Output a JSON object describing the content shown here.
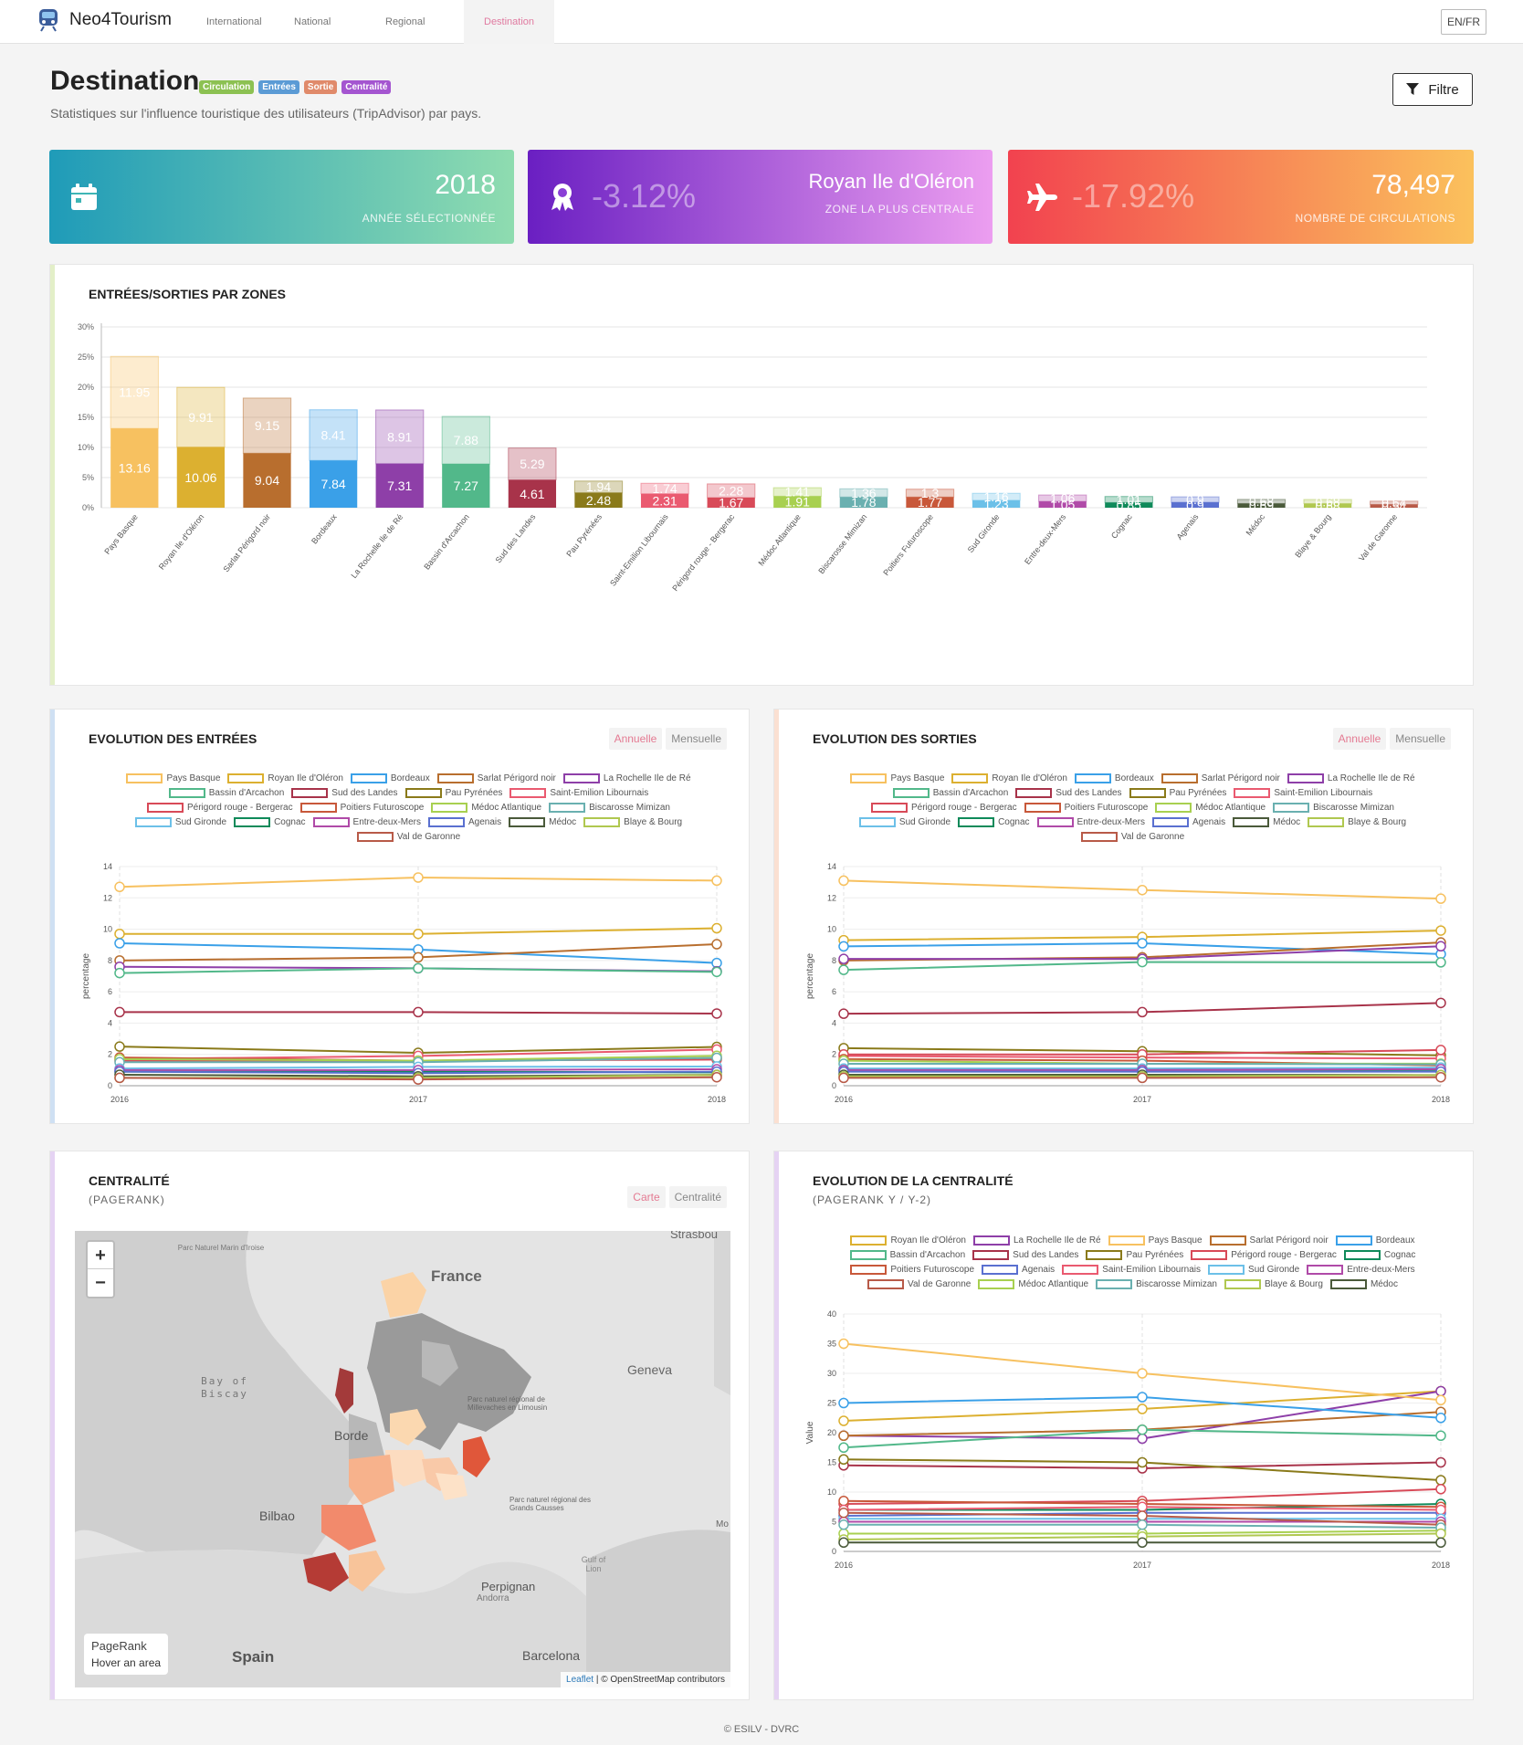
{
  "nav": {
    "brand": "Neo4Tourism",
    "items": [
      "International",
      "National",
      "Regional",
      "Destination"
    ],
    "lang": "EN/FR"
  },
  "header": {
    "title": "Destination",
    "badges": [
      {
        "label": "Circulation",
        "color": "#8cc152"
      },
      {
        "label": "Entrées",
        "color": "#5b9bd5"
      },
      {
        "label": "Sortie",
        "color": "#e08a6a"
      },
      {
        "label": "Centralité",
        "color": "#a455d0"
      }
    ],
    "subtitle": "Statistiques sur l'influence touristique des utilisateurs (TripAdvisor) par pays.",
    "filter": "Filtre"
  },
  "kpis": [
    {
      "value": "2018",
      "label": "ANNÉE SÉLECTIONNÉE",
      "pct": "",
      "colors": [
        "#1f9bb8",
        "#8fdcb0"
      ]
    },
    {
      "value": "Royan Ile d'Oléron",
      "label": "ZONE LA PLUS CENTRALE",
      "pct": "-3.12%",
      "colors": [
        "#6a1fc2",
        "#ec9ef0"
      ]
    },
    {
      "value": "78,497",
      "label": "NOMBRE DE CIRCULATIONS",
      "pct": "-17.92%",
      "colors": [
        "#f2424f",
        "#fbc15c"
      ]
    }
  ],
  "zones_card": {
    "title": "ENTRÉES/SORTIES PAR ZONES"
  },
  "chart_data": [
    {
      "type": "bar",
      "title": "ENTRÉES/SORTIES PAR ZONES",
      "ylim": [
        0,
        30
      ],
      "yticks": [
        "0%",
        "5%",
        "10%",
        "15%",
        "20%",
        "25%",
        "30%"
      ],
      "categories": [
        "Pays Basque",
        "Royan Ile d'Oléron",
        "Sarlat Périgord noir",
        "Bordeaux",
        "La Rochelle Ile de Ré",
        "Bassin d'Arcachon",
        "Sud des Landes",
        "Pau Pyrénées",
        "Saint-Emilion Libournais",
        "Périgord rouge - Bergerac",
        "Médoc Atlantique",
        "Biscarosse Mimizan",
        "Poitiers Futuroscope",
        "Sud Gironde",
        "Entre-deux-Mers",
        "Cognac",
        "Agenais",
        "Médoc",
        "Blaye & Bourg",
        "Val de Garonne"
      ],
      "series": [
        {
          "values": [
            13.16,
            10.06,
            9.04,
            7.84,
            7.31,
            7.27,
            4.61,
            2.48,
            2.31,
            1.67,
            1.91,
            1.78,
            1.77,
            1.23,
            1.05,
            0.85,
            0.9,
            0.69,
            0.68,
            0.54
          ]
        },
        {
          "values": [
            11.95,
            9.91,
            9.15,
            8.41,
            8.91,
            7.88,
            5.29,
            1.94,
            1.74,
            2.28,
            1.41,
            1.36,
            1.3,
            1.16,
            1.06,
            1.01,
            0.9,
            0.68,
            0.68,
            0.54
          ]
        }
      ],
      "colors": [
        "#f7c160",
        "#dcb030",
        "#b86e2e",
        "#3aa0e8",
        "#8e3fa8",
        "#52b88a",
        "#a8334a",
        "#8a7a1a",
        "#ea5a70",
        "#d84a58",
        "#a8d050",
        "#6ab0b0",
        "#c8583a",
        "#6cc0e8",
        "#b04aa8",
        "#0f8a5a",
        "#5a70d0",
        "#4a5a3a",
        "#b0c850",
        "#b85a48"
      ]
    },
    {
      "type": "line",
      "title": "EVOLUTION DES ENTRÉES",
      "x": [
        "2016",
        "2017",
        "2018"
      ],
      "ylabel": "percentage",
      "ylim": [
        0,
        14
      ],
      "series": [
        {
          "name": "Pays Basque",
          "values": [
            12.7,
            13.3,
            13.1
          ]
        },
        {
          "name": "Royan Ile d'Oléron",
          "values": [
            9.7,
            9.7,
            10.06
          ]
        },
        {
          "name": "Bordeaux",
          "values": [
            9.1,
            8.7,
            7.84
          ]
        },
        {
          "name": "Sarlat Périgord noir",
          "values": [
            8.0,
            8.2,
            9.04
          ]
        },
        {
          "name": "La Rochelle Ile de Ré",
          "values": [
            7.6,
            7.5,
            7.31
          ]
        },
        {
          "name": "Bassin d'Arcachon",
          "values": [
            7.2,
            7.5,
            7.27
          ]
        },
        {
          "name": "Sud des Landes",
          "values": [
            4.7,
            4.7,
            4.61
          ]
        },
        {
          "name": "Pau Pyrénées",
          "values": [
            2.5,
            2.1,
            2.48
          ]
        },
        {
          "name": "Saint-Emilion Libournais",
          "values": [
            1.7,
            1.9,
            2.31
          ]
        },
        {
          "name": "Périgord rouge - Bergerac",
          "values": [
            1.6,
            1.6,
            1.67
          ]
        },
        {
          "name": "Poitiers Futuroscope",
          "values": [
            1.8,
            1.6,
            1.77
          ]
        },
        {
          "name": "Médoc Atlantique",
          "values": [
            1.7,
            1.6,
            1.91
          ]
        },
        {
          "name": "Biscarosse Mimizan",
          "values": [
            1.5,
            1.5,
            1.78
          ]
        },
        {
          "name": "Sud Gironde",
          "values": [
            1.1,
            1.2,
            1.23
          ]
        },
        {
          "name": "Cognac",
          "values": [
            0.9,
            0.9,
            0.85
          ]
        },
        {
          "name": "Entre-deux-Mers",
          "values": [
            1.0,
            1.0,
            1.05
          ]
        },
        {
          "name": "Agenais",
          "values": [
            0.9,
            0.8,
            0.9
          ]
        },
        {
          "name": "Médoc",
          "values": [
            0.7,
            0.6,
            0.69
          ]
        },
        {
          "name": "Blaye & Bourg",
          "values": [
            0.5,
            0.5,
            0.68
          ]
        },
        {
          "name": "Val de Garonne",
          "values": [
            0.5,
            0.4,
            0.54
          ]
        }
      ]
    },
    {
      "type": "line",
      "title": "EVOLUTION DES SORTIES",
      "x": [
        "2016",
        "2017",
        "2018"
      ],
      "ylabel": "percentage",
      "ylim": [
        0,
        14
      ],
      "series": [
        {
          "name": "Pays Basque",
          "values": [
            13.1,
            12.5,
            11.95
          ]
        },
        {
          "name": "Royan Ile d'Oléron",
          "values": [
            9.3,
            9.5,
            9.91
          ]
        },
        {
          "name": "Bordeaux",
          "values": [
            8.9,
            9.1,
            8.41
          ]
        },
        {
          "name": "Sarlat Périgord noir",
          "values": [
            8.0,
            8.2,
            9.15
          ]
        },
        {
          "name": "La Rochelle Ile de Ré",
          "values": [
            8.1,
            8.1,
            8.91
          ]
        },
        {
          "name": "Bassin d'Arcachon",
          "values": [
            7.4,
            7.9,
            7.88
          ]
        },
        {
          "name": "Sud des Landes",
          "values": [
            4.6,
            4.7,
            5.29
          ]
        },
        {
          "name": "Pau Pyrénées",
          "values": [
            2.4,
            2.2,
            1.94
          ]
        },
        {
          "name": "Saint-Emilion Libournais",
          "values": [
            1.9,
            1.8,
            1.74
          ]
        },
        {
          "name": "Périgord rouge - Bergerac",
          "values": [
            2.0,
            2.0,
            2.28
          ]
        },
        {
          "name": "Poitiers Futuroscope",
          "values": [
            1.7,
            1.6,
            1.3
          ]
        },
        {
          "name": "Médoc Atlantique",
          "values": [
            1.6,
            1.4,
            1.41
          ]
        },
        {
          "name": "Biscarosse Mimizan",
          "values": [
            1.4,
            1.4,
            1.36
          ]
        },
        {
          "name": "Sud Gironde",
          "values": [
            1.1,
            1.1,
            1.16
          ]
        },
        {
          "name": "Cognac",
          "values": [
            1.0,
            1.0,
            1.01
          ]
        },
        {
          "name": "Entre-deux-Mers",
          "values": [
            1.0,
            1.0,
            1.06
          ]
        },
        {
          "name": "Agenais",
          "values": [
            0.9,
            0.9,
            0.9
          ]
        },
        {
          "name": "Médoc",
          "values": [
            0.7,
            0.7,
            0.68
          ]
        },
        {
          "name": "Blaye & Bourg",
          "values": [
            0.6,
            0.6,
            0.68
          ]
        },
        {
          "name": "Val de Garonne",
          "values": [
            0.5,
            0.5,
            0.54
          ]
        }
      ]
    },
    {
      "type": "line",
      "title": "EVOLUTION DE LA CENTRALITÉ",
      "x": [
        "2016",
        "2017",
        "2018"
      ],
      "ylabel": "Value",
      "ylim": [
        0,
        40
      ],
      "series": [
        {
          "name": "Royan Ile d'Oléron",
          "values": [
            22,
            24,
            27
          ]
        },
        {
          "name": "La Rochelle Ile de Ré",
          "values": [
            19.5,
            19,
            27
          ]
        },
        {
          "name": "Pays Basque",
          "values": [
            35,
            30,
            25.5
          ]
        },
        {
          "name": "Sarlat Périgord noir",
          "values": [
            19.5,
            20.5,
            23.5
          ]
        },
        {
          "name": "Bordeaux",
          "values": [
            25,
            26,
            22.5
          ]
        },
        {
          "name": "Bassin d'Arcachon",
          "values": [
            17.5,
            20.5,
            19.5
          ]
        },
        {
          "name": "Sud des Landes",
          "values": [
            14.5,
            14,
            15
          ]
        },
        {
          "name": "Pau Pyrénées",
          "values": [
            15.5,
            15,
            12
          ]
        },
        {
          "name": "Périgord rouge - Bergerac",
          "values": [
            8,
            8.5,
            10.5
          ]
        },
        {
          "name": "Cognac",
          "values": [
            7,
            7,
            8
          ]
        },
        {
          "name": "Poitiers Futuroscope",
          "values": [
            8.5,
            8,
            7.5
          ]
        },
        {
          "name": "Agenais",
          "values": [
            6,
            6.5,
            6.5
          ]
        },
        {
          "name": "Saint-Emilion Libournais",
          "values": [
            7,
            7.5,
            7
          ]
        },
        {
          "name": "Sud Gironde",
          "values": [
            5.5,
            5.5,
            5.5
          ]
        },
        {
          "name": "Entre-deux-Mers",
          "values": [
            5,
            5,
            5
          ]
        },
        {
          "name": "Val de Garonne",
          "values": [
            6.5,
            6,
            4.5
          ]
        },
        {
          "name": "Médoc Atlantique",
          "values": [
            3,
            3,
            3.5
          ]
        },
        {
          "name": "Biscarosse Mimizan",
          "values": [
            4.5,
            4.5,
            4
          ]
        },
        {
          "name": "Blaye & Bourg",
          "values": [
            2,
            2.5,
            3
          ]
        },
        {
          "name": "Médoc",
          "values": [
            1.5,
            1.5,
            1.5
          ]
        }
      ]
    }
  ],
  "line_colors": {
    "Pays Basque": "#f7c160",
    "Royan Ile d'Oléron": "#dcb030",
    "Bordeaux": "#3aa0e8",
    "Sarlat Périgord noir": "#b86e2e",
    "La Rochelle Ile de Ré": "#8e3fa8",
    "Bassin d'Arcachon": "#52b88a",
    "Sud des Landes": "#a8334a",
    "Pau Pyrénées": "#8a7a1a",
    "Saint-Emilion Libournais": "#ea5a70",
    "Périgord rouge - Bergerac": "#d84a58",
    "Poitiers Futuroscope": "#c8583a",
    "Médoc Atlantique": "#a8d050",
    "Biscarosse Mimizan": "#6ab0b0",
    "Sud Gironde": "#6cc0e8",
    "Cognac": "#0f8a5a",
    "Entre-deux-Mers": "#b04aa8",
    "Agenais": "#5a70d0",
    "Médoc": "#4a5a3a",
    "Blaye & Bourg": "#b0c850",
    "Val de Garonne": "#b85a48"
  },
  "entrees_card": {
    "title": "EVOLUTION DES ENTRÉES",
    "toggle": [
      "Annuelle",
      "Mensuelle"
    ]
  },
  "sorties_card": {
    "title": "EVOLUTION DES SORTIES",
    "toggle": [
      "Annuelle",
      "Mensuelle"
    ]
  },
  "centrality_card": {
    "title": "CENTRALITÉ",
    "sub": "(PAGERANK)",
    "toggle": [
      "Carte",
      "Centralité"
    ],
    "map": {
      "labels": [
        "France",
        "Bay of Biscay",
        "Geneva",
        "Borde",
        "Bilbao",
        "Spain",
        "Perpignan",
        "Andorra",
        "Barcelona",
        "Gulf of Lion",
        "Parc Naturel Marin d'Iroise",
        "Parc naturel régional de Millevaches en Limousin",
        "Parc naturel régional des Grands Causses",
        "Strasbou",
        "Mo"
      ],
      "info_title": "PageRank",
      "info_text": "Hover an area",
      "attribution_link": "Leaflet",
      "attribution": "| © OpenStreetMap contributors",
      "zoom_in": "+",
      "zoom_out": "−"
    }
  },
  "evolution_card": {
    "title": "EVOLUTION DE LA CENTRALITÉ",
    "sub": "(PAGERANK Y / Y-2)"
  },
  "footer": "© ESILV - DVRC"
}
